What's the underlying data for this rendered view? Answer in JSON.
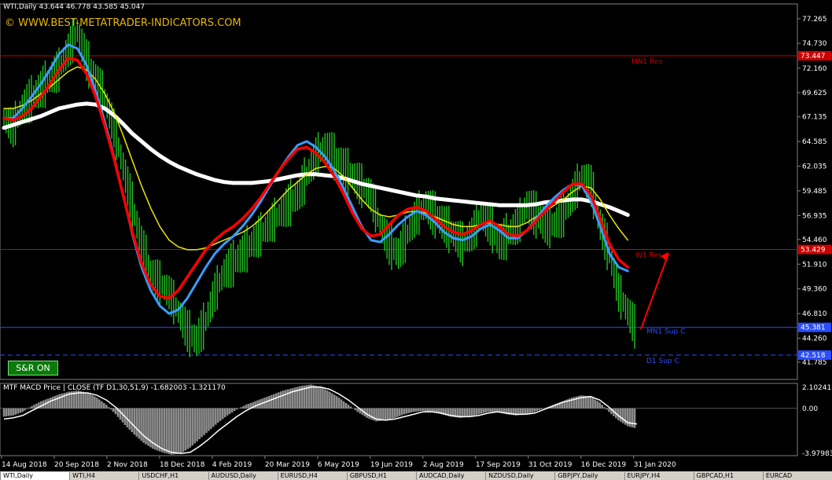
{
  "header": {
    "title_line": "WTI,Daily  43.644 46.778 43.585 45.047",
    "watermark": "© WWW.BEST-METATRADER-INDICATORS.COM"
  },
  "sr_button": {
    "label": "S&R  ON"
  },
  "macd": {
    "label": "MTF MACD Price | CLOSE  (TF D1,30,51,9) -1.682003 -1.321170"
  },
  "colors": {
    "background": "#000000",
    "candles": "#22c322",
    "ma_white": "#ffffff",
    "ma_yellow": "#e8e800",
    "ma_red": "#ff0000",
    "ma_blue": "#3b9cff",
    "resistance": "#cc0000",
    "support": "#2a4dff",
    "histogram": "#8c8c8c",
    "arrow": "#ff0000"
  },
  "tabs": [
    "WTI,Daily",
    "WTI,H4",
    "USDCHF,H1",
    "AUDUSD,Daily",
    "EURUSD,H4",
    "GBPUSD,H1",
    "AUDCAD,Daily",
    "NZDUSD,Daily",
    "GBPJPY,Daily",
    "EURJPY,H4",
    "GBPCAD,H1",
    "EURCAD"
  ],
  "chart_data": [
    {
      "type": "line",
      "panel": "price",
      "ylim": [
        40.0,
        78.8
      ],
      "price_ticks": [
        "77.265",
        "74.730",
        "72.160",
        "69.625",
        "67.135",
        "64.585",
        "62.035",
        "59.485",
        "56.935",
        "54.460",
        "51.910",
        "49.360",
        "46.810",
        "44.260",
        "41.785"
      ],
      "date_ticks": [
        "14 Aug 2018",
        "20 Sep 2018",
        "2 Nov 2018",
        "18 Dec 2018",
        "4 Feb 2019",
        "20 Mar 2019",
        "6 May 2019",
        "19 Jun 2019",
        "2 Aug 2019",
        "17 Sep 2019",
        "31 Oct 2019",
        "16 Dec 2019",
        "31 Jan 2020"
      ],
      "levels": [
        {
          "name": "MN1 Res",
          "value": 73.447,
          "label": "73.447",
          "kind": "resistance",
          "style": "solid"
        },
        {
          "name": "W1 Res",
          "value": 53.429,
          "label": "53.429",
          "kind": "resistance",
          "style": "solid"
        },
        {
          "name": "MN1 Sup C",
          "value": 45.381,
          "label": "45.381",
          "kind": "support",
          "style": "solid"
        },
        {
          "name": "D1 Sup C",
          "value": 42.518,
          "label": "42.518",
          "kind": "support",
          "style": "dashed"
        }
      ],
      "series": [
        {
          "role": "price",
          "values": [
            67,
            66,
            68,
            69,
            70,
            71,
            72,
            74,
            76,
            73,
            71,
            69,
            66,
            62,
            58,
            54,
            51,
            50,
            49,
            47,
            45,
            44,
            46,
            49,
            51,
            52,
            53,
            54,
            55,
            56,
            57,
            58,
            59,
            61,
            63,
            64,
            63,
            62,
            61,
            60,
            59,
            56,
            54,
            53,
            55,
            57,
            58,
            57,
            56,
            55,
            54,
            55,
            57,
            56,
            54,
            55,
            56,
            58,
            57,
            56,
            56,
            57,
            59,
            61,
            60,
            56,
            53,
            49,
            47,
            45.0
          ]
        },
        {
          "role": "ma-white",
          "values": [
            66,
            66.3,
            66.6,
            66.9,
            67.2,
            67.6,
            68.0,
            68.2,
            68.4,
            68.5,
            68.4,
            68.0,
            67.3,
            66.4,
            65.4,
            64.6,
            63.8,
            63.1,
            62.5,
            62.0,
            61.6,
            61.2,
            60.9,
            60.6,
            60.4,
            60.3,
            60.3,
            60.3,
            60.4,
            60.5,
            60.7,
            60.9,
            61.1,
            61.2,
            61.2,
            61.1,
            61.0,
            60.8,
            60.5,
            60.2,
            60.0,
            59.8,
            59.6,
            59.4,
            59.2,
            59.0,
            58.9,
            58.7,
            58.6,
            58.5,
            58.4,
            58.3,
            58.2,
            58.1,
            58.0,
            58.0,
            58.0,
            58.0,
            58.1,
            58.3,
            58.4,
            58.5,
            58.6,
            58.6,
            58.4,
            58.1,
            57.8,
            57.4,
            57.0
          ]
        },
        {
          "role": "ma-yellow",
          "values": [
            68,
            68,
            68.3,
            68.8,
            69.5,
            70.2,
            71.0,
            71.8,
            72.3,
            72.0,
            71.0,
            69.5,
            67.6,
            65.2,
            62.6,
            60.0,
            57.7,
            55.8,
            54.4,
            53.7,
            53.4,
            53.4,
            53.6,
            54.0,
            54.4,
            54.8,
            55.2,
            55.8,
            56.6,
            57.6,
            58.6,
            59.6,
            60.4,
            61.2,
            61.8,
            62.0,
            61.8,
            61.0,
            59.8,
            58.6,
            57.6,
            57.0,
            56.8,
            57.0,
            57.3,
            57.4,
            57.2,
            56.8,
            56.4,
            56.0,
            55.8,
            55.8,
            56.0,
            56.2,
            56.0,
            55.8,
            55.8,
            56.2,
            56.8,
            57.4,
            58.0,
            58.6,
            59.4,
            60.0,
            59.8,
            58.6,
            57.0,
            55.6,
            54.4
          ]
        },
        {
          "role": "ma-blue",
          "values": [
            67,
            67,
            68.0,
            69.2,
            70.5,
            72.0,
            73.6,
            74.6,
            74.2,
            72.5,
            69.8,
            66.6,
            63.0,
            59.0,
            55.0,
            51.6,
            49.2,
            47.6,
            46.8,
            47.2,
            48.4,
            50.0,
            51.6,
            53.0,
            54.0,
            54.8,
            55.8,
            57.0,
            58.4,
            60.0,
            61.6,
            63.0,
            64.2,
            64.6,
            64.0,
            63.0,
            61.6,
            59.8,
            57.8,
            55.8,
            54.4,
            54.2,
            55.0,
            56.0,
            56.8,
            57.4,
            57.0,
            56.2,
            55.2,
            54.6,
            54.4,
            54.8,
            55.6,
            56.0,
            55.4,
            54.6,
            54.6,
            55.4,
            56.6,
            57.8,
            58.8,
            59.6,
            60.2,
            60.0,
            58.4,
            55.8,
            53.0,
            51.6,
            51.2
          ]
        },
        {
          "role": "ma-red",
          "values": [
            67,
            66.8,
            67.2,
            68.0,
            69.2,
            70.5,
            72.0,
            73.2,
            73.0,
            71.6,
            69.2,
            66.2,
            62.8,
            59.0,
            55.2,
            52.0,
            49.8,
            48.6,
            48.4,
            49.2,
            50.6,
            52.0,
            53.4,
            54.4,
            55.2,
            55.8,
            56.6,
            57.6,
            58.8,
            60.2,
            61.6,
            62.8,
            63.8,
            64.0,
            63.4,
            62.4,
            61.0,
            59.2,
            57.2,
            55.6,
            54.8,
            55.0,
            56.0,
            57.0,
            57.6,
            57.8,
            57.4,
            56.6,
            55.8,
            55.2,
            55.0,
            55.4,
            56.0,
            56.4,
            55.8,
            55.0,
            54.8,
            55.4,
            56.4,
            57.4,
            58.4,
            59.4,
            60.2,
            60.2,
            59.0,
            56.6,
            54.0,
            52.4,
            51.6
          ]
        }
      ]
    },
    {
      "type": "bar",
      "panel": "macd",
      "ylim": [
        -3.97983,
        2.102412
      ],
      "ticks": [
        "2.102412",
        "0.00",
        "-3.97983"
      ],
      "zero_line": 0.0,
      "series": [
        {
          "role": "histogram",
          "values": [
            -0.7,
            -0.6,
            -0.3,
            0.2,
            0.6,
            0.9,
            1.2,
            1.4,
            1.5,
            1.3,
            0.9,
            0.3,
            -0.5,
            -1.4,
            -2.2,
            -2.9,
            -3.4,
            -3.7,
            -3.9,
            -3.8,
            -3.3,
            -2.6,
            -1.9,
            -1.2,
            -0.6,
            -0.1,
            0.3,
            0.6,
            0.9,
            1.2,
            1.5,
            1.7,
            1.9,
            2.0,
            1.8,
            1.4,
            0.9,
            0.3,
            -0.3,
            -0.8,
            -1.1,
            -1.0,
            -0.8,
            -0.5,
            -0.3,
            -0.2,
            -0.3,
            -0.5,
            -0.7,
            -0.8,
            -0.7,
            -0.5,
            -0.3,
            -0.3,
            -0.5,
            -0.6,
            -0.5,
            -0.3,
            0.0,
            0.3,
            0.6,
            0.9,
            1.1,
            1.0,
            0.5,
            -0.3,
            -1.0,
            -1.5,
            -1.7
          ]
        },
        {
          "role": "signal",
          "values": [
            -0.9,
            -0.8,
            -0.6,
            -0.2,
            0.2,
            0.6,
            0.9,
            1.2,
            1.3,
            1.3,
            1.1,
            0.7,
            0.1,
            -0.7,
            -1.5,
            -2.3,
            -2.9,
            -3.4,
            -3.7,
            -3.8,
            -3.7,
            -3.2,
            -2.6,
            -1.9,
            -1.3,
            -0.7,
            -0.2,
            0.2,
            0.5,
            0.8,
            1.1,
            1.4,
            1.6,
            1.8,
            1.8,
            1.6,
            1.2,
            0.7,
            0.1,
            -0.5,
            -0.9,
            -1.0,
            -0.9,
            -0.7,
            -0.5,
            -0.3,
            -0.3,
            -0.4,
            -0.6,
            -0.7,
            -0.7,
            -0.6,
            -0.4,
            -0.3,
            -0.4,
            -0.5,
            -0.5,
            -0.4,
            -0.1,
            0.2,
            0.5,
            0.7,
            0.9,
            1.0,
            0.7,
            0.1,
            -0.6,
            -1.2,
            -1.32
          ]
        }
      ]
    }
  ]
}
